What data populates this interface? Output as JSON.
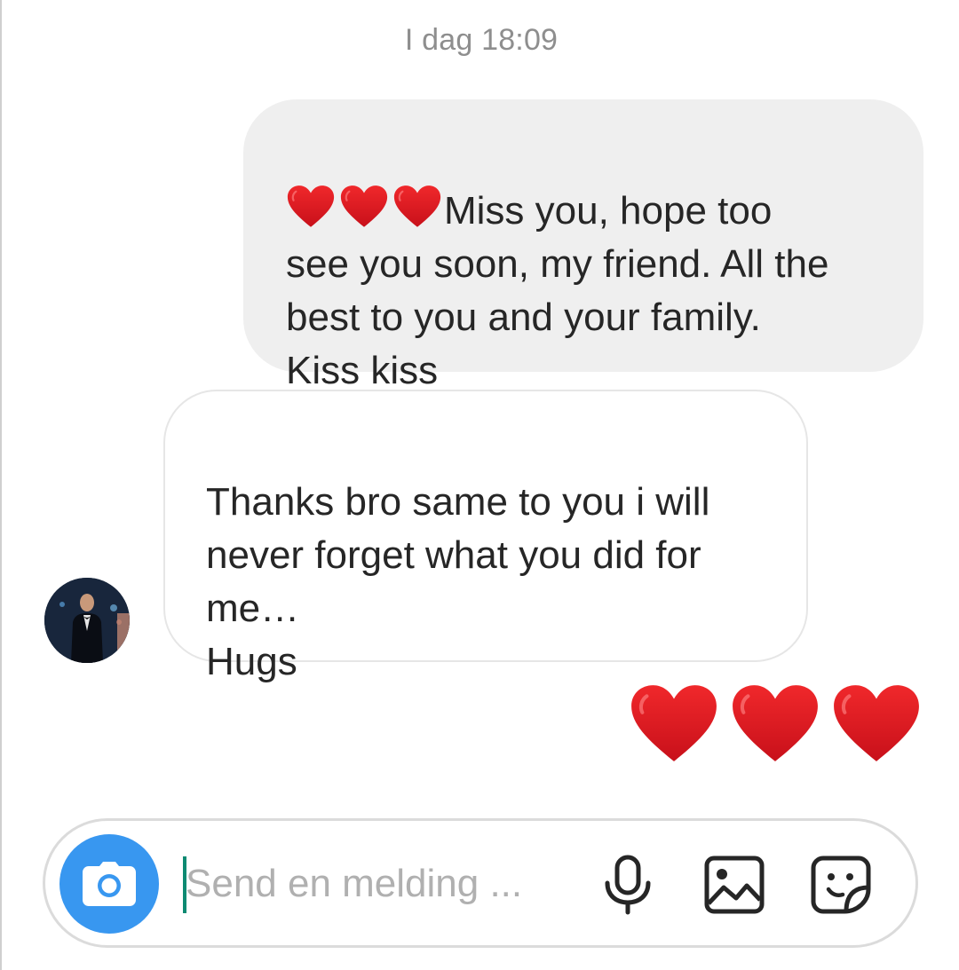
{
  "thread": {
    "timestamp": "I dag 18:09",
    "messages": [
      {
        "direction": "outgoing",
        "emoji_prefix": "❤️❤️❤️",
        "text": "Miss you, hope too\nsee you soon, my friend. All the\nbest to you and your family.\nKiss kiss"
      },
      {
        "direction": "incoming",
        "text": "Thanks bro same to you i will\nnever forget what you did for\nme…\nHugs",
        "avatar_icon": "user-avatar"
      },
      {
        "direction": "outgoing",
        "emoji_only": "❤️❤️❤️"
      }
    ]
  },
  "composer": {
    "placeholder": "Send en melding ...",
    "value": "",
    "camera_icon": "camera-icon",
    "mic_icon": "microphone-icon",
    "gallery_icon": "gallery-icon",
    "sticker_icon": "sticker-icon"
  },
  "colors": {
    "outgoing_bubble": "#efefef",
    "camera_button": "#3897f0",
    "heart": "#e0191f",
    "cursor": "#0d8a72"
  }
}
